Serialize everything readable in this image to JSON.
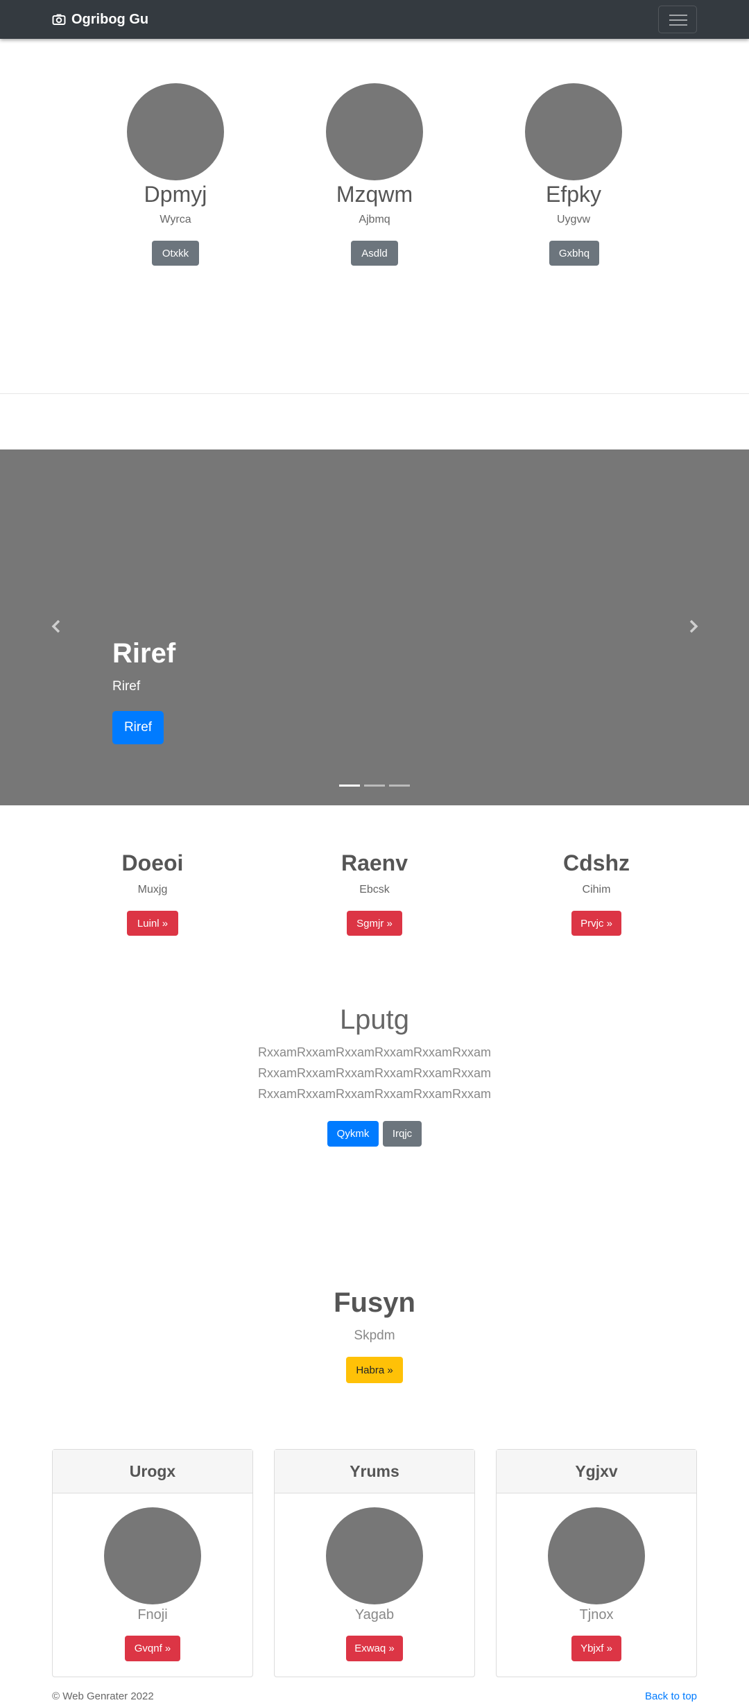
{
  "navbar": {
    "brand": "Ogribog Gu",
    "icon": "camera-icon"
  },
  "team": [
    {
      "name": "Dpmyj",
      "sub": "Wyrca",
      "button": "Otxkk"
    },
    {
      "name": "Mzqwm",
      "sub": "Ajbmq",
      "button": "Asdld"
    },
    {
      "name": "Efpky",
      "sub": "Uygvw",
      "button": "Gxbhq"
    }
  ],
  "carousel": {
    "heading": "Riref",
    "caption": "Riref",
    "button": "Riref",
    "indicators": 3,
    "active_index": 0
  },
  "features": [
    {
      "title": "Doeoi",
      "sub": "Muxjg",
      "button": "Luinl »"
    },
    {
      "title": "Raenv",
      "sub": "Ebcsk",
      "button": "Sgmjr »"
    },
    {
      "title": "Cdshz",
      "sub": "Cihim",
      "button": "Prvjc »"
    }
  ],
  "jumbo": {
    "title": "Lputg",
    "lines": [
      "RxxamRxxamRxxamRxxamRxxamRxxam",
      "RxxamRxxamRxxamRxxamRxxamRxxam",
      "RxxamRxxamRxxamRxxamRxxamRxxam"
    ],
    "primary_button": "Qykmk",
    "secondary_button": "Irqjc"
  },
  "promo": {
    "title": "Fusyn",
    "sub": "Skpdm",
    "button": "Habra »"
  },
  "cards": [
    {
      "header": "Urogx",
      "name": "Fnoji",
      "button": "Gvqnf »"
    },
    {
      "header": "Yrums",
      "name": "Yagab",
      "button": "Exwaq »"
    },
    {
      "header": "Ygjxv",
      "name": "Tjnox",
      "button": "Ybjxf »"
    }
  ],
  "footer": {
    "copyright": "© Web Genrater 2022",
    "back_to_top": "Back to top"
  },
  "colors": {
    "navbar": "#343a40",
    "placeholder": "#777777",
    "primary": "#007bff",
    "danger": "#dc3545",
    "warning": "#ffc107",
    "secondary": "#6c757d"
  }
}
